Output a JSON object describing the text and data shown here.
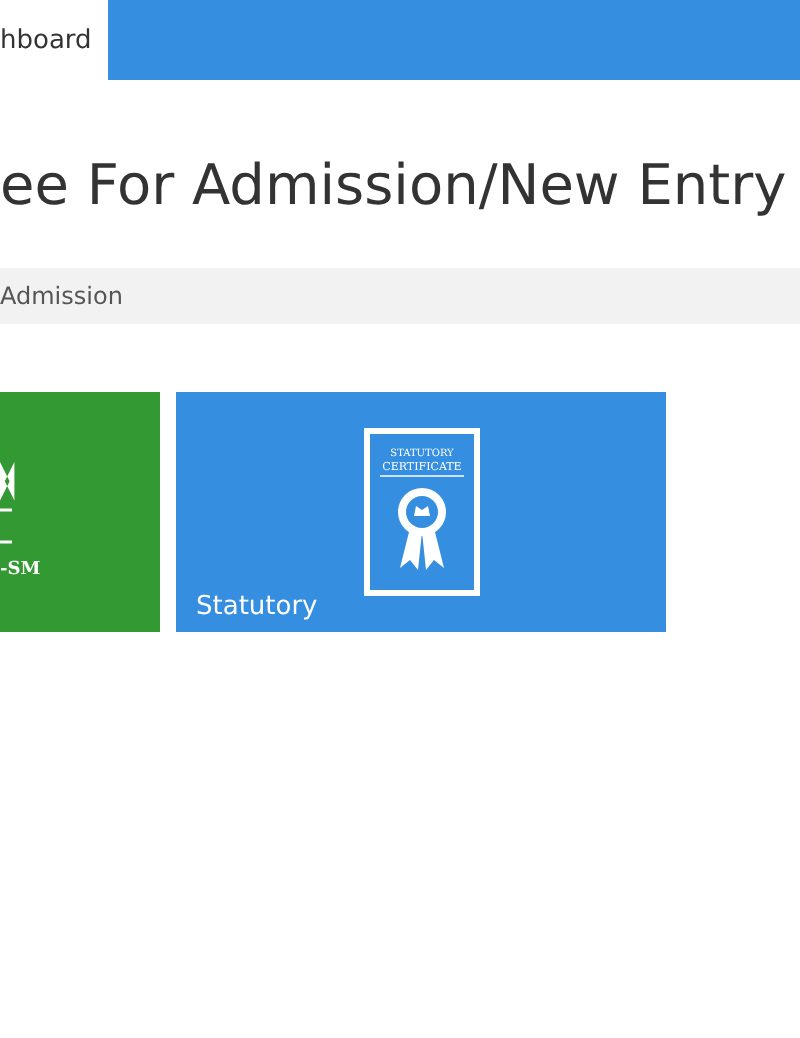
{
  "tabs": [
    {
      "label": "hboard",
      "selected": true
    }
  ],
  "title": "ee For Admission/New Entry",
  "breadcrumb": "Admission",
  "tiles": [
    {
      "kind": "logo",
      "color": "#339933",
      "badge": "-SM"
    },
    {
      "kind": "certificate",
      "color": "#358ee0",
      "label": "Statutory",
      "line1": "STATUTORY",
      "line2": "CERTIFICATE"
    }
  ]
}
